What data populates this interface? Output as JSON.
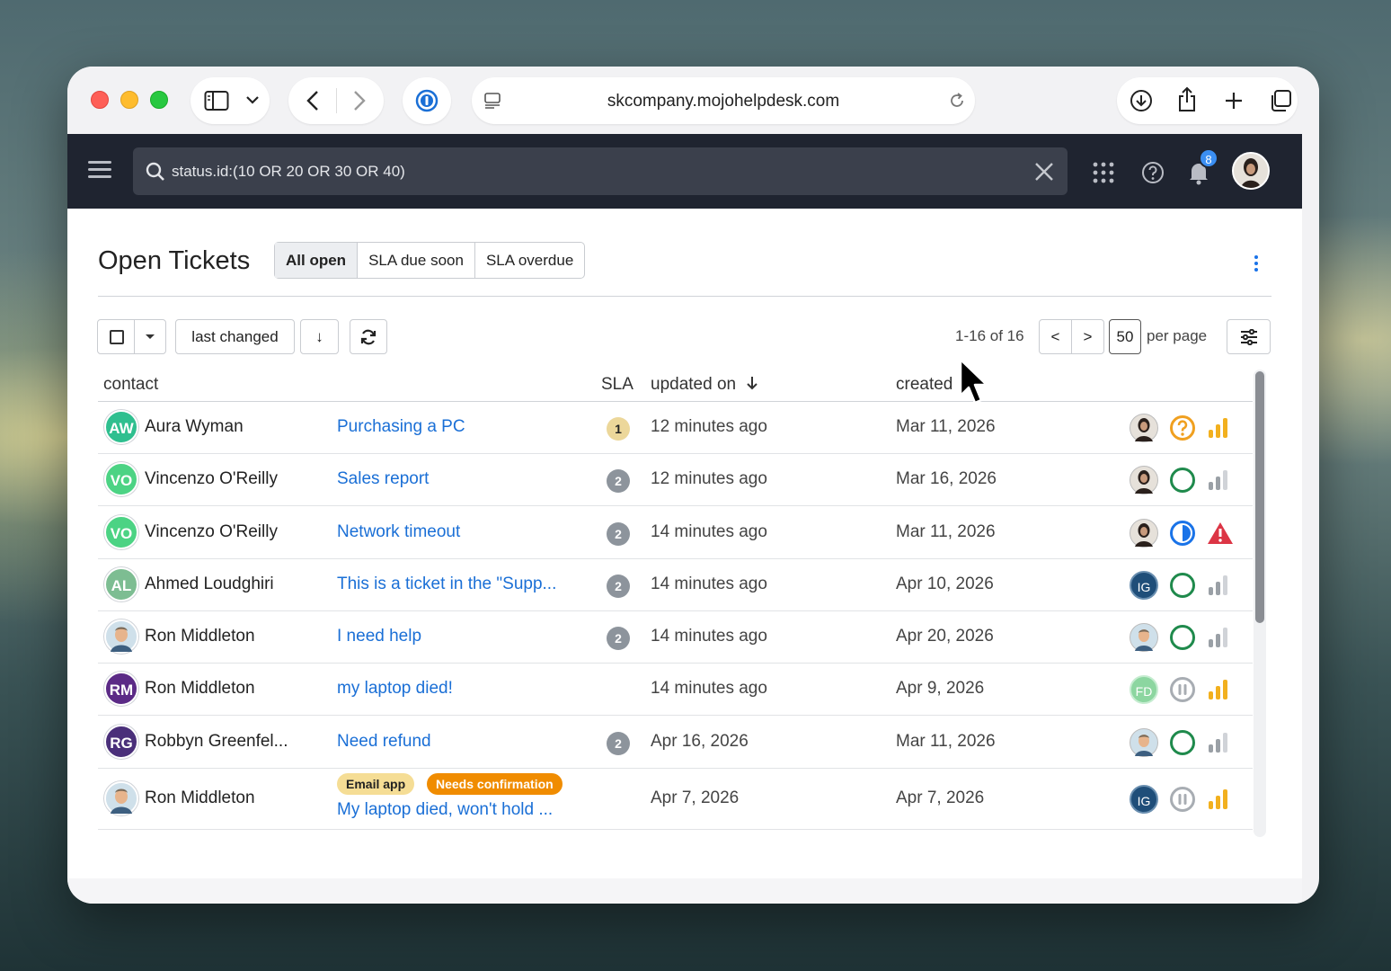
{
  "browser": {
    "url": "skcompany.mojohelpdesk.com"
  },
  "header": {
    "search_query": "status.id:(10 OR 20 OR 30 OR 40)",
    "notification_count": "8"
  },
  "page": {
    "title": "Open Tickets",
    "filters": [
      "All open",
      "SLA due soon",
      "SLA overdue"
    ],
    "active_filter": "All open"
  },
  "controls": {
    "sort_label": "last changed",
    "sort_direction_icon": "↓",
    "paging_info": "1-16 of 16",
    "prev_label": "<",
    "next_label": ">",
    "per_page_value": "50",
    "per_page_label": "per page"
  },
  "table": {
    "columns": {
      "contact": "contact",
      "sla": "SLA",
      "updated_on": "updated on",
      "created": "created"
    },
    "rows": [
      {
        "initials": "AW",
        "avatar_color": "#2fbf8f",
        "contact": "Aura Wyman",
        "subject": "Purchasing a PC",
        "sla": "1",
        "sla_color": "#ecd79a",
        "updated": "12 minutes ago",
        "created": "Mar 11, 2026",
        "agent": "photo-woman",
        "status": "question",
        "priority": "high"
      },
      {
        "initials": "VO",
        "avatar_color": "#4cd384",
        "contact": "Vincenzo O'Reilly",
        "subject": "Sales report",
        "sla": "2",
        "sla_color": "#8d949c",
        "updated": "12 minutes ago",
        "created": "Mar 16, 2026",
        "agent": "photo-woman",
        "status": "open",
        "priority": "low"
      },
      {
        "initials": "VO",
        "avatar_color": "#4cd384",
        "contact": "Vincenzo O'Reilly",
        "subject": "Network timeout",
        "sla": "2",
        "sla_color": "#8d949c",
        "updated": "14 minutes ago",
        "created": "Mar 11, 2026",
        "agent": "photo-woman",
        "status": "in-progress",
        "priority": "urgent"
      },
      {
        "initials": "AL",
        "avatar_color": "#7dbd92",
        "contact": "Ahmed Loudghiri",
        "subject": "This is a ticket in the \"Supp...",
        "sla": "2",
        "sla_color": "#8d949c",
        "updated": "14 minutes ago",
        "created": "Apr 10, 2026",
        "agent": "IG",
        "status": "open",
        "priority": "low"
      },
      {
        "initials": "",
        "avatar_color": "#6b8fa8",
        "contact": "Ron Middleton",
        "subject": "I need help",
        "sla": "2",
        "sla_color": "#8d949c",
        "updated": "14 minutes ago",
        "created": "Apr 20, 2026",
        "agent": "photo-man",
        "status": "open",
        "priority": "low"
      },
      {
        "initials": "RM",
        "avatar_color": "#5b2a86",
        "contact": "Ron Middleton",
        "subject": "my laptop died!",
        "sla": "",
        "sla_color": "",
        "updated": "14 minutes ago",
        "created": "Apr 9, 2026",
        "agent": "FD",
        "status": "paused",
        "priority": "high"
      },
      {
        "initials": "RG",
        "avatar_color": "#4a2f7a",
        "contact": "Robbyn Greenfel...",
        "subject": "Need refund",
        "sla": "2",
        "sla_color": "#8d949c",
        "updated": "Apr 16, 2026",
        "created": "Mar 11, 2026",
        "agent": "photo-man",
        "status": "open",
        "priority": "low"
      },
      {
        "initials": "",
        "avatar_color": "#6b8fa8",
        "contact": "Ron Middleton",
        "subject": "My laptop died, won't hold ...",
        "sla": "",
        "sla_color": "",
        "updated": "Apr 7, 2026",
        "created": "Apr 7, 2026",
        "agent": "IG",
        "status": "paused",
        "priority": "high",
        "tags": [
          "Email app",
          "Needs confirmation"
        ]
      }
    ]
  },
  "colors": {
    "link": "#1a6fd6",
    "header_bg": "#1f2430",
    "priority_high": "#f2b01e",
    "priority_low": "#9aa0a6",
    "status_open": "#1f8a4c",
    "status_question": "#f0a020",
    "status_in_progress": "#1a73e8",
    "urgent": "#dc3545"
  }
}
